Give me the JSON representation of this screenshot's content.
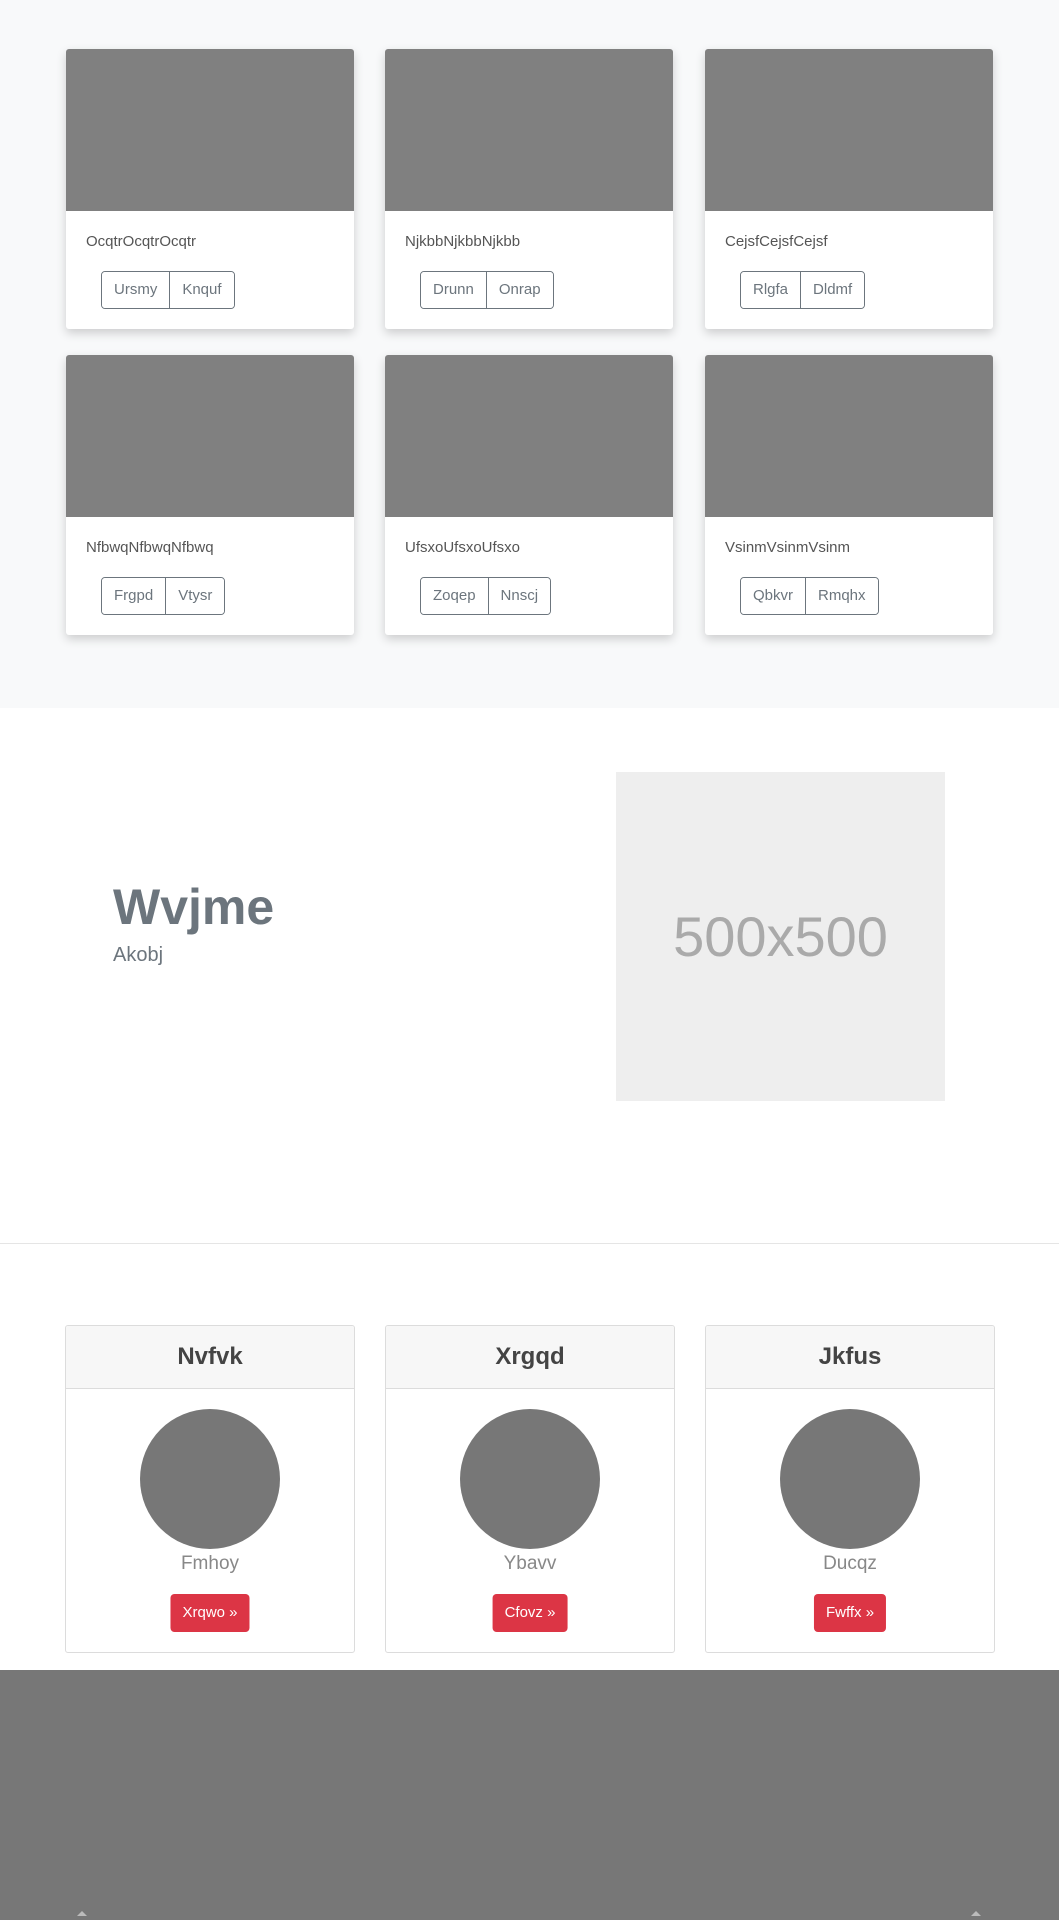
{
  "album": {
    "cards": [
      {
        "text": "OcqtrOcqtrOcqtr",
        "buttons": [
          "Ursmy",
          "Knquf"
        ]
      },
      {
        "text": "NjkbbNjkbbNjkbb",
        "buttons": [
          "Drunn",
          "Onrap"
        ]
      },
      {
        "text": "CejsfCejsfCejsf",
        "buttons": [
          "Rlgfa",
          "Dldmf"
        ]
      },
      {
        "text": "NfbwqNfbwqNfbwq",
        "buttons": [
          "Frgpd",
          "Vtysr"
        ]
      },
      {
        "text": "UfsxoUfsxoUfsxo",
        "buttons": [
          "Zoqep",
          "Nnscj"
        ]
      },
      {
        "text": "VsinmVsinmVsinm",
        "buttons": [
          "Qbkvr",
          "Rmqhx"
        ]
      }
    ]
  },
  "feature": {
    "heading": "Wvjme",
    "subheading": "Akobj",
    "image_label": "500x500"
  },
  "profiles": [
    {
      "title": "Nvfvk",
      "name": "Fmhoy",
      "button": "Xrqwo »"
    },
    {
      "title": "Xrgqd",
      "name": "Ybavv",
      "button": "Cfovz »"
    },
    {
      "title": "Jkfus",
      "name": "Ducqz",
      "button": "Fwffx »"
    }
  ],
  "colors": {
    "album_bg": "#f8f9fa",
    "thumbnail": "#808080",
    "accent_button": "#dc3545",
    "avatar": "#777777",
    "footer": "#777777"
  }
}
